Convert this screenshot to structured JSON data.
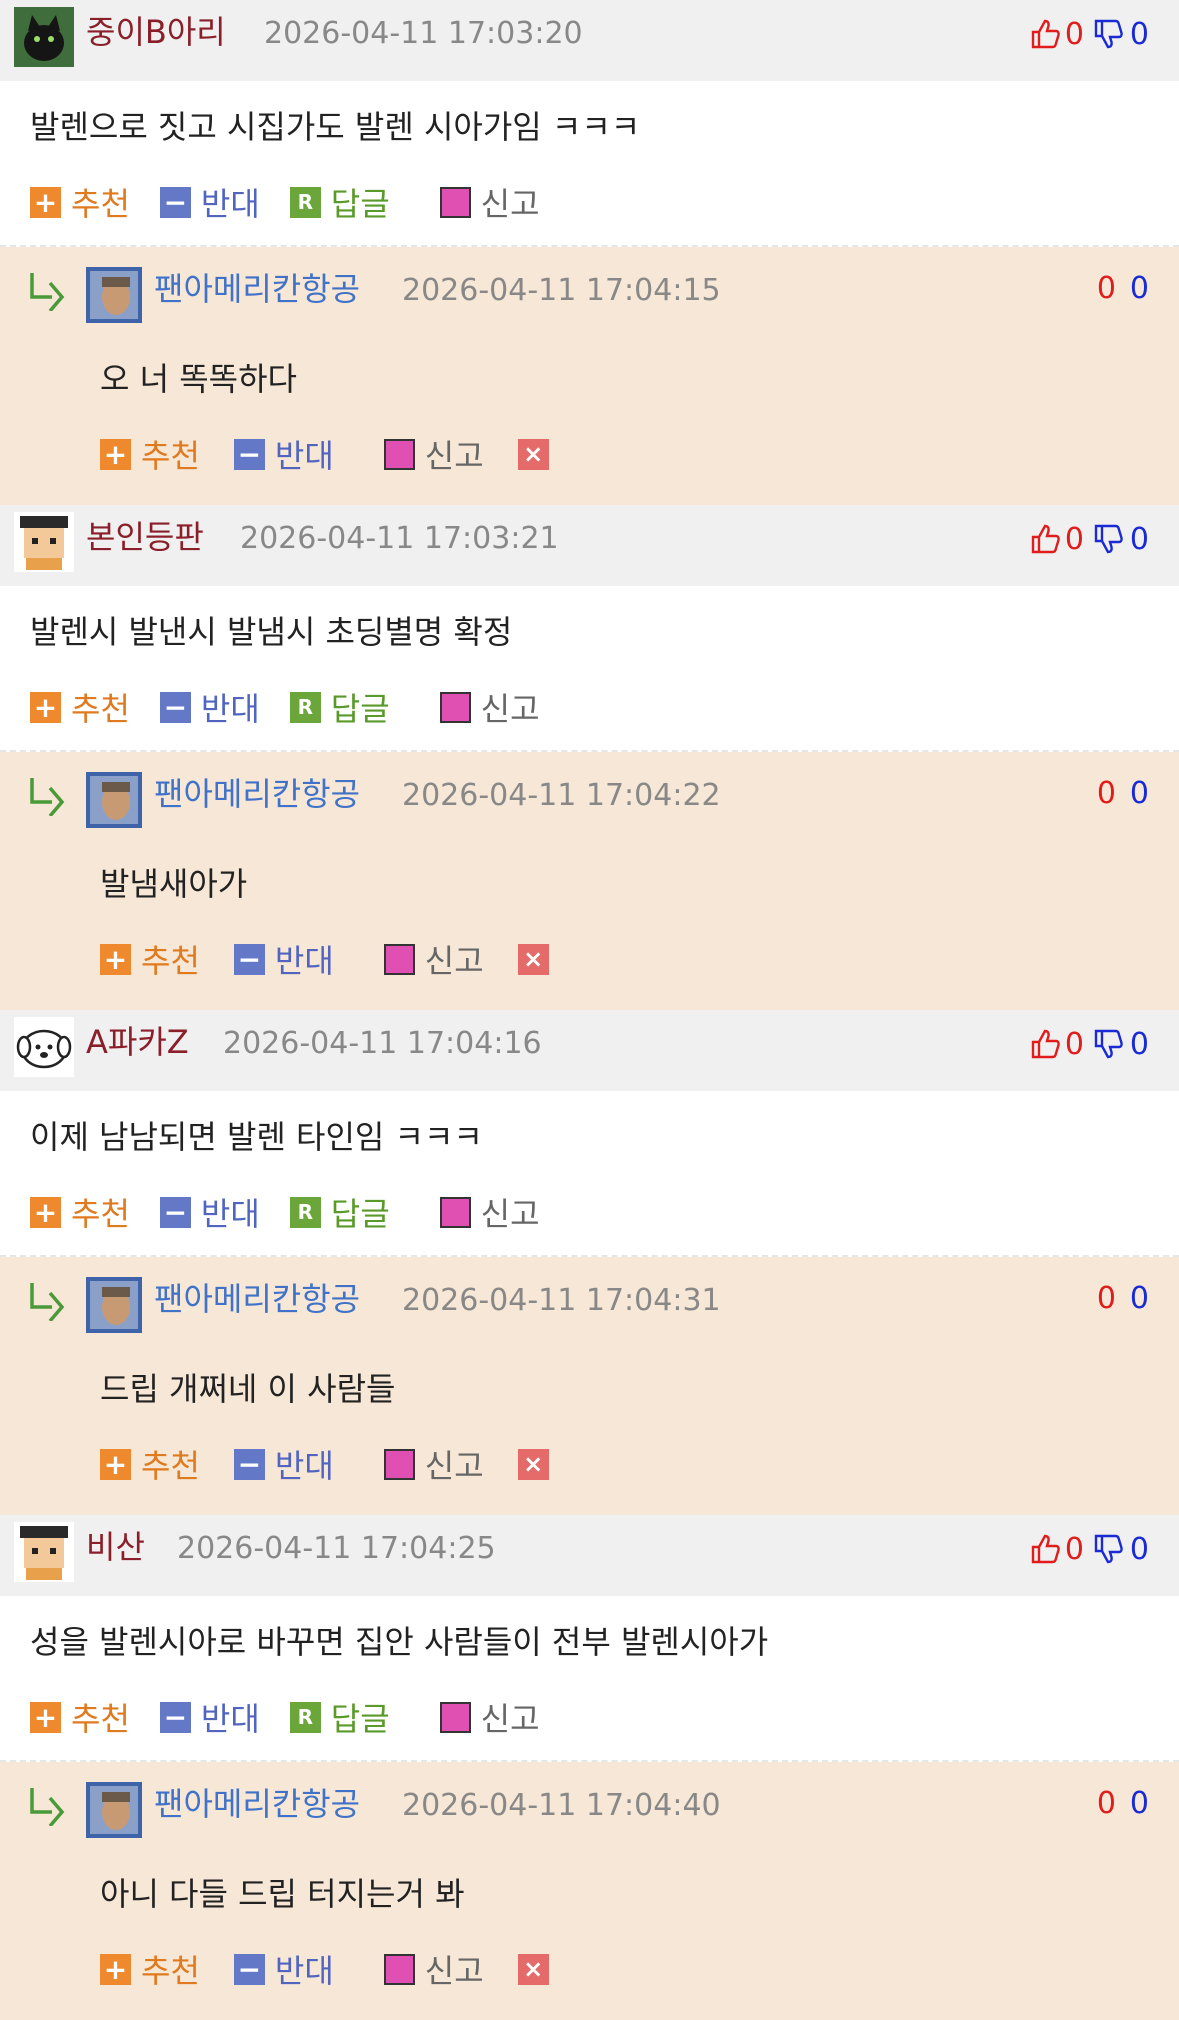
{
  "labels": {
    "recommend": "추천",
    "oppose": "반대",
    "reply": "답글",
    "report": "신고",
    "reply_icon_char": "R",
    "plus_char": "+",
    "minus_char": "−",
    "delete_char": "×"
  },
  "threads": [
    {
      "comment": {
        "avatar": "black-cat-avatar",
        "nickname": "중이B아리",
        "date": "2026-04-11 17:03:20",
        "up": "0",
        "down": "0",
        "text": "발렌으로 짓고 시집가도 발렌 시아가임 ㅋㅋㅋ"
      },
      "reply": {
        "avatar": "photo-avatar",
        "nickname": "팬아메리칸항공",
        "date": "2026-04-11 17:04:15",
        "up": "0",
        "down": "0",
        "text": "오 너 똑똑하다"
      }
    },
    {
      "comment": {
        "avatar": "pixel-boy-avatar",
        "nickname": "본인등판",
        "date": "2026-04-11 17:03:21",
        "up": "0",
        "down": "0",
        "text": "발렌시 발낸시 발냄시 초딩별명 확정"
      },
      "reply": {
        "avatar": "photo-avatar",
        "nickname": "팬아메리칸항공",
        "date": "2026-04-11 17:04:22",
        "up": "0",
        "down": "0",
        "text": "발냄새아가"
      }
    },
    {
      "comment": {
        "avatar": "dog-avatar",
        "nickname": "A파카Z",
        "date": "2026-04-11 17:04:16",
        "up": "0",
        "down": "0",
        "text": "이제 남남되면 발렌 타인임 ㅋㅋㅋ"
      },
      "reply": {
        "avatar": "photo-avatar",
        "nickname": "팬아메리칸항공",
        "date": "2026-04-11 17:04:31",
        "up": "0",
        "down": "0",
        "text": "드립 개쩌네 이 사람들"
      }
    },
    {
      "comment": {
        "avatar": "pixel-boy-avatar",
        "nickname": "비산",
        "date": "2026-04-11 17:04:25",
        "up": "0",
        "down": "0",
        "text": "성을 발렌시아로 바꾸면 집안 사람들이 전부 발렌시아가"
      },
      "reply": {
        "avatar": "photo-avatar",
        "nickname": "팬아메리칸항공",
        "date": "2026-04-11 17:04:40",
        "up": "0",
        "down": "0",
        "text": "아니 다들 드립 터지는거 봐"
      }
    }
  ]
}
